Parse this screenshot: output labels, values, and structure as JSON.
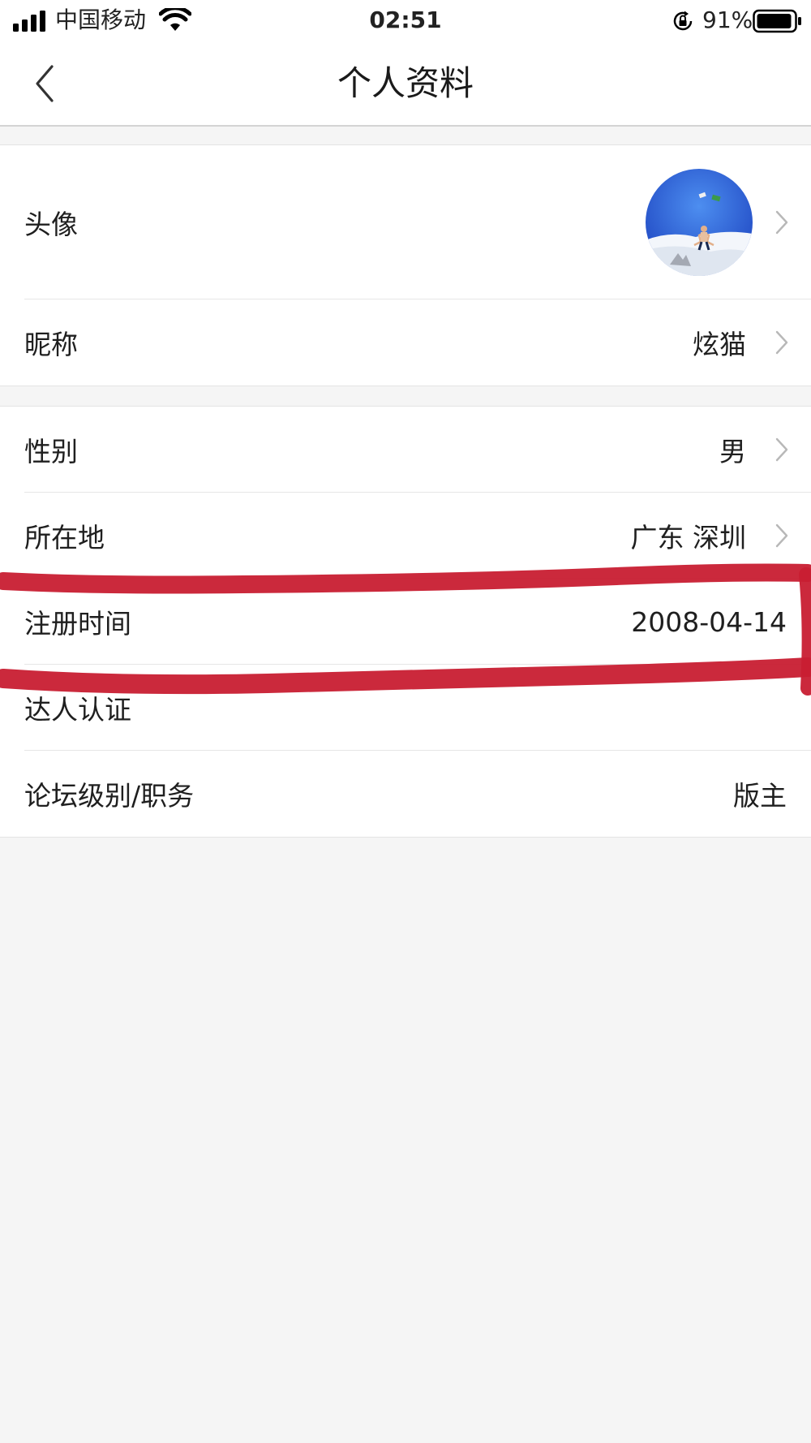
{
  "status_bar": {
    "carrier": "中国移动",
    "time": "02:51",
    "battery": "91%",
    "icons": [
      "signal-icon",
      "wifi-icon",
      "orientation-lock-icon",
      "battery-icon"
    ]
  },
  "nav": {
    "title": "个人资料",
    "back_icon": "chevron-left-icon"
  },
  "profile": {
    "avatar": {
      "label": "头像"
    },
    "nickname": {
      "label": "昵称",
      "value": "炫猫"
    },
    "gender": {
      "label": "性别",
      "value": "男"
    },
    "location": {
      "label": "所在地",
      "value": "广东 深圳"
    },
    "register_time": {
      "label": "注册时间",
      "value": "2008-04-14"
    },
    "expert_cert": {
      "label": "达人认证",
      "value": ""
    },
    "forum_level": {
      "label": "论坛级别/职务",
      "value": "版主"
    }
  },
  "annotation": {
    "color": "#c81e32"
  },
  "colors": {
    "background": "#f5f5f5",
    "row_background": "#ffffff",
    "text": "#1f1f1f",
    "chevron": "#b8b8b8"
  }
}
